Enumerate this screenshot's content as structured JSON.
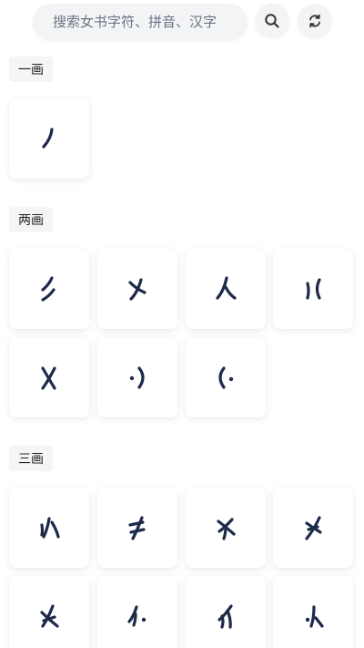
{
  "search": {
    "placeholder": "搜索女书字符、拼音、汉字",
    "search_icon": "search-icon",
    "refresh_icon": "refresh-icon"
  },
  "sections": [
    {
      "label": "一画",
      "characters": [
        "stroke-1-1"
      ]
    },
    {
      "label": "两画",
      "characters": [
        "stroke-2-1",
        "stroke-2-2",
        "stroke-2-3",
        "stroke-2-4",
        "stroke-2-5",
        "stroke-2-6",
        "stroke-2-7"
      ]
    },
    {
      "label": "三画",
      "characters": [
        "stroke-3-1",
        "stroke-3-2",
        "stroke-3-3",
        "stroke-3-4",
        "stroke-3-5",
        "stroke-3-6",
        "stroke-3-7",
        "stroke-3-8"
      ]
    }
  ],
  "colors": {
    "glyph": "#1e2a4a",
    "card_bg": "#ffffff",
    "label_bg": "#f5f5f7",
    "search_bg": "#f3f4f6"
  }
}
